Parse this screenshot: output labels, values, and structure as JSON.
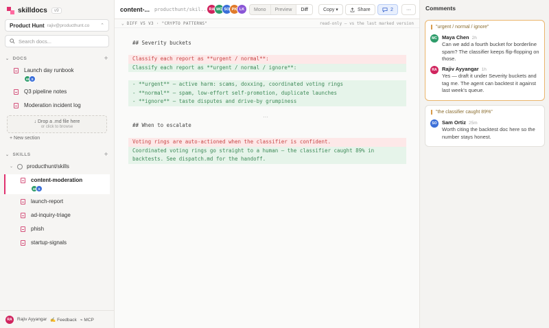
{
  "app": {
    "name": "skilldocs",
    "version": "v9"
  },
  "workspace": {
    "name": "Product Hunt",
    "email": "rajiv@producthunt.co"
  },
  "search": {
    "placeholder": "Search docs..."
  },
  "docs_section": {
    "title": "DOCS",
    "items": [
      {
        "label": "Launch day runbook",
        "avatars": [
          "M",
          "S"
        ]
      },
      {
        "label": "Q3 pipeline notes"
      },
      {
        "label": "Moderation incident log"
      }
    ],
    "dropzone": {
      "line1": "↓ Drop a .md file here",
      "line2": "or click to browse"
    },
    "new_section": "+ New section"
  },
  "skills_section": {
    "title": "SKILLS",
    "folder": "producthunt/skills",
    "items": [
      {
        "label": "content-moderation",
        "active": true,
        "avatars": [
          "M",
          "S"
        ]
      },
      {
        "label": "launch-report"
      },
      {
        "label": "ad-inquiry-triage"
      },
      {
        "label": "phish"
      },
      {
        "label": "startup-signals"
      }
    ]
  },
  "footer": {
    "user_initials": "RA",
    "user": "Rajiv Ayyangar",
    "feedback": "✍ Feedback",
    "mcp": "⌁ MCP"
  },
  "header": {
    "title": "content-...",
    "path": "producthunt/skil...",
    "avatars": [
      {
        "initials": "RA",
        "color": "#d0245e"
      },
      {
        "initials": "MC",
        "color": "#2e9c6a"
      },
      {
        "initials": "SO",
        "color": "#3b6fd8"
      },
      {
        "initials": "PK",
        "color": "#e07b2b"
      },
      {
        "initials": "LK",
        "color": "#8a56d6"
      }
    ],
    "view_modes": [
      "Mono",
      "Preview",
      "Diff"
    ],
    "active_mode": "Diff",
    "copy_label": "Copy ▾",
    "share_label": "Share",
    "comment_count": "2",
    "more_label": "···"
  },
  "diffbar": {
    "left": "⌄ DIFF  V5 V3 · \"CRYPTO PATTERNS\"",
    "right": "read-only — vs the last marked version"
  },
  "diff": {
    "heading1": "## Severity buckets",
    "del1": "Classify each report as **urgent / normal**:",
    "add1": "Classify each report as **urgent / normal / ignore**:",
    "add_block": [
      "- **urgent** — active harm: scams, doxxing, coordinated voting rings",
      "- **normal** — spam, low-effort self-promotion, duplicate launches",
      "- **ignore** — taste disputes and drive-by grumpiness"
    ],
    "ellipsis": "···",
    "heading2": "## When to escalate",
    "del2": "Voting rings are auto-actioned when the classifier is confident.",
    "add2": [
      "Coordinated voting rings go straight to a human — the classifier caught 89% in",
      "backtests. See dispatch.md for the handoff."
    ]
  },
  "comments": {
    "title": "Comments",
    "threads": [
      {
        "quote": "\"urgent / normal / ignore\"",
        "messages": [
          {
            "initials": "MC",
            "color": "#2e9c6a",
            "author": "Maya Chen",
            "time": "2h",
            "body": "Can we add a fourth bucket for borderline spam? The classifier keeps flip-flopping on those."
          },
          {
            "initials": "RA",
            "color": "#d0245e",
            "author": "Rajiv Ayyangar",
            "time": "1h",
            "body": "Yes — draft it under Severity buckets and tag me. The agent can backtest it against last week's queue."
          }
        ]
      },
      {
        "quote": "\"the classifier caught 89%\"",
        "messages": [
          {
            "initials": "SO",
            "color": "#3b6fd8",
            "author": "Sam Ortiz",
            "time": "25m",
            "body": "Worth citing the backtest doc here so the number stays honest."
          }
        ]
      }
    ]
  }
}
